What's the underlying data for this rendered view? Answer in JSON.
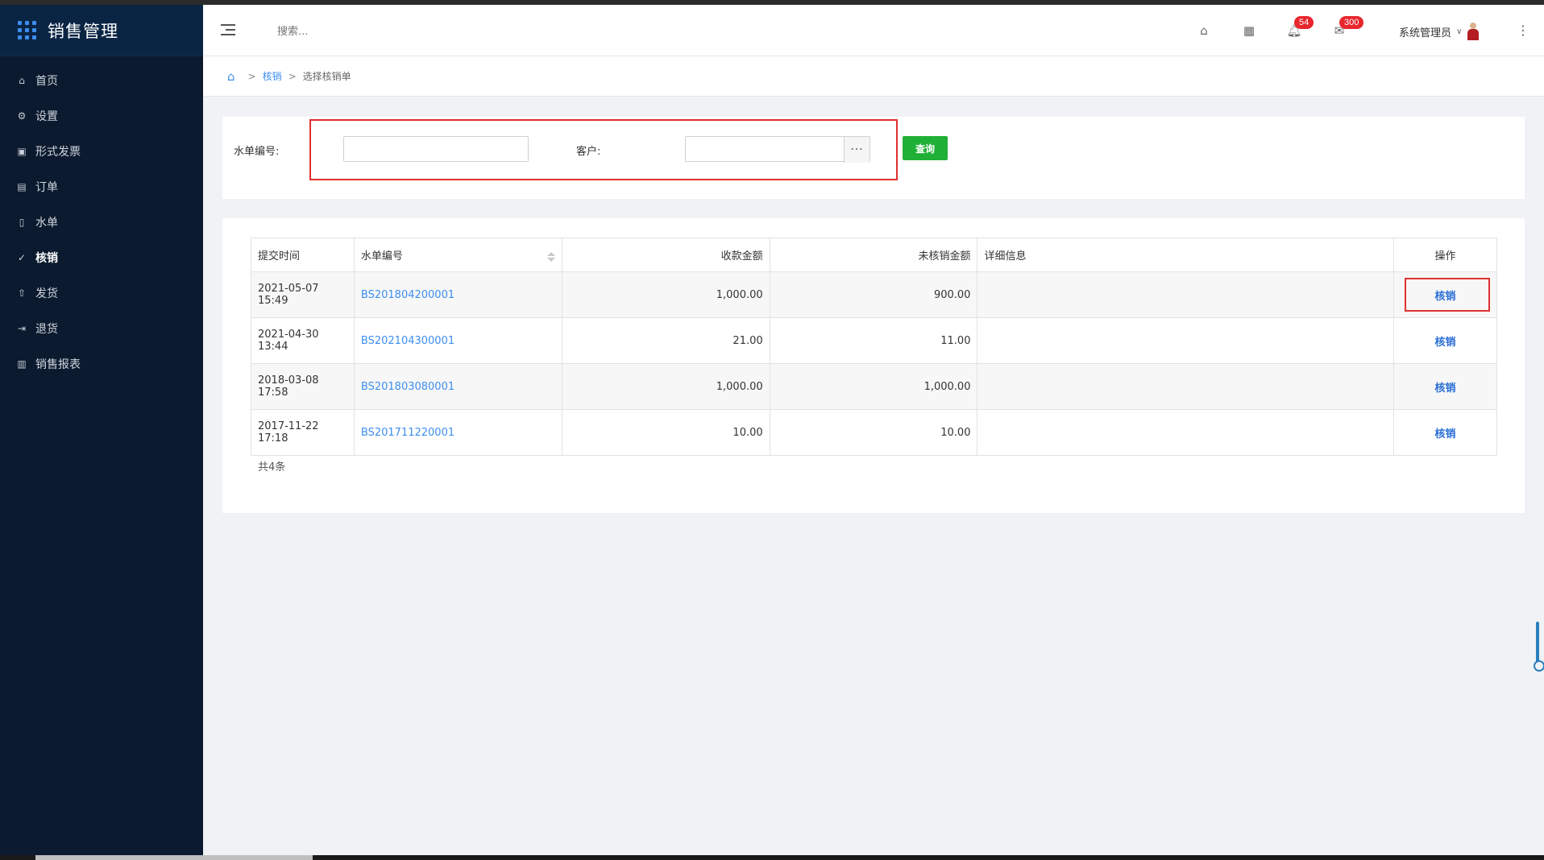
{
  "app": {
    "title": "销售管理"
  },
  "sidebar": {
    "items": [
      {
        "label": "首页",
        "icon": "home-icon"
      },
      {
        "label": "设置",
        "icon": "gear-icon"
      },
      {
        "label": "形式发票",
        "icon": "invoice-icon"
      },
      {
        "label": "订单",
        "icon": "order-icon"
      },
      {
        "label": "水单",
        "icon": "receipt-icon"
      },
      {
        "label": "核销",
        "icon": "check-circle-icon",
        "active": true
      },
      {
        "label": "发货",
        "icon": "upload-icon"
      },
      {
        "label": "退货",
        "icon": "return-icon"
      },
      {
        "label": "销售报表",
        "icon": "bar-chart-icon"
      }
    ]
  },
  "header": {
    "search_placeholder": "搜索...",
    "notifications_count": "54",
    "messages_count": "300",
    "user_name": "系统管理员"
  },
  "breadcrumb": {
    "parent": "核销",
    "current": "选择核销单"
  },
  "filter": {
    "receipt_no_label": "水单编号:",
    "receipt_no_value": "",
    "customer_label": "客户:",
    "customer_value": "",
    "query_button": "查询"
  },
  "table": {
    "columns": [
      "提交时间",
      "水单编号",
      "收款金额",
      "未核销金额",
      "详细信息",
      "操作"
    ],
    "rows": [
      {
        "date": "2021-05-07",
        "time": "15:49",
        "no": "BS201804200001",
        "amount": "1,000.00",
        "unsettled": "900.00",
        "detail": "",
        "action": "核销"
      },
      {
        "date": "2021-04-30",
        "time": "13:44",
        "no": "BS202104300001",
        "amount": "21.00",
        "unsettled": "11.00",
        "detail": "",
        "action": "核销"
      },
      {
        "date": "2018-03-08",
        "time": "17:58",
        "no": "BS201803080001",
        "amount": "1,000.00",
        "unsettled": "1,000.00",
        "detail": "",
        "action": "核销"
      },
      {
        "date": "2017-11-22",
        "time": "17:18",
        "no": "BS201711220001",
        "amount": "10.00",
        "unsettled": "10.00",
        "detail": "",
        "action": "核销"
      }
    ],
    "total": "共4条"
  },
  "colors": {
    "accent": "#3d8ef0",
    "sidebar_bg": "#0b1a2e",
    "query_btn": "#1fb037",
    "highlight": "#e03030"
  }
}
